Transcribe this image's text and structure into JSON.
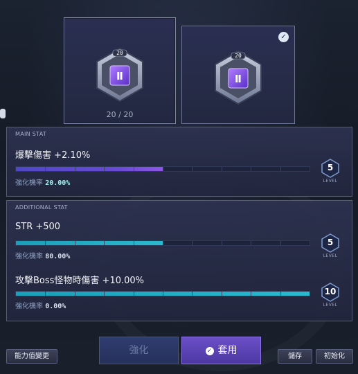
{
  "cards": [
    {
      "badge": "20",
      "count": "20 / 20",
      "selected": false
    },
    {
      "badge": "20",
      "selected": true
    }
  ],
  "main_stat": {
    "title": "MAIN STAT",
    "name": "爆擊傷害 +2.10%",
    "rate_label": "強化機率",
    "rate_value": "20.00%",
    "level": "5",
    "level_label": "LEVEL",
    "progress": 0.5
  },
  "additional_stat": {
    "title": "ADDITIONAL STAT",
    "stats": [
      {
        "name": "STR +500",
        "rate_label": "強化機率",
        "rate_value": "80.00%",
        "level": "5",
        "level_label": "LEVEL",
        "progress": 0.5
      },
      {
        "name": "攻擊Boss怪物時傷害 +10.00%",
        "rate_label": "強化機率",
        "rate_value": "0.00%",
        "level": "10",
        "level_label": "LEVEL",
        "progress": 1.0
      }
    ]
  },
  "buttons": {
    "enhance": "強化",
    "apply": "套用",
    "stat_change": "能力值變更",
    "save": "儲存",
    "init": "初始化"
  },
  "colors": {
    "main_bar": "#6a4bd6",
    "additional_bar": "#2ab9cf",
    "apply_button": "#5a43b6"
  }
}
